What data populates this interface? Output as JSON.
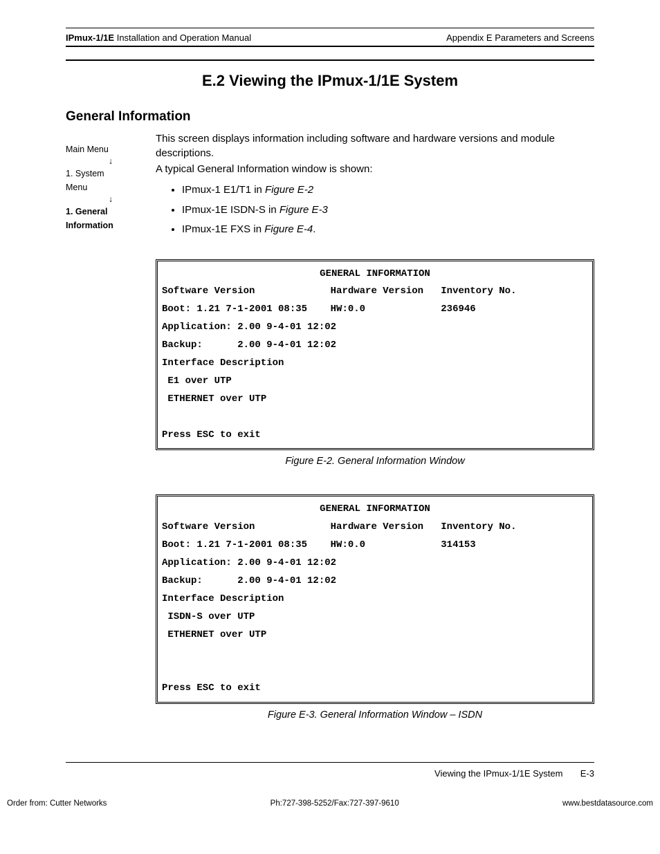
{
  "header": {
    "left_bold": "IPmux-1/1E",
    "left_rest": " Installation and Operation Manual",
    "right": "Appendix E  Parameters and Screens"
  },
  "section_title": "E.2  Viewing the IPmux-1/1E System",
  "subhead": "General Information",
  "breadcrumb": {
    "l1": "Main Menu",
    "l2": "1. System",
    "l3": "Menu",
    "l4a": "1. General",
    "l4b": "Information"
  },
  "intro": {
    "p1": "This screen displays information including software and hardware versions and module descriptions.",
    "p2": "A typical General Information window is shown:"
  },
  "bullets": [
    {
      "text": "IPmux-1 E1/T1 in ",
      "fig": "Figure E-2"
    },
    {
      "text": "IPmux-1E ISDN-S in ",
      "fig": "Figure E-3"
    },
    {
      "text": "IPmux-1E FXS in ",
      "fig": "Figure E-4",
      "tail": "."
    }
  ],
  "term1": {
    "title": "GENERAL INFORMATION",
    "row_hdr": "Software Version             Hardware Version   Inventory No.",
    "boot": "Boot: 1.21 7-1-2001 08:35    HW:0.0             236946",
    "app": "Application: 2.00 9-4-01 12:02",
    "bak": "Backup:      2.00 9-4-01 12:02",
    "ifd": "Interface Description",
    "if1": " E1 over UTP",
    "if2": " ETHERNET over UTP",
    "exit": "Press ESC to exit"
  },
  "cap1": "Figure E-2.  General Information Window",
  "term2": {
    "title": "GENERAL INFORMATION",
    "row_hdr": "Software Version             Hardware Version   Inventory No.",
    "boot": "Boot: 1.21 7-1-2001 08:35    HW:0.0             314153",
    "app": "Application: 2.00 9-4-01 12:02",
    "bak": "Backup:      2.00 9-4-01 12:02",
    "ifd": "Interface Description",
    "if1": " ISDN-S over UTP",
    "if2": " ETHERNET over UTP",
    "exit": "Press ESC to exit"
  },
  "cap2": "Figure E-3.  General Information Window – ISDN",
  "footer": {
    "section": "Viewing the IPmux-1/1E System",
    "page": "E-3"
  },
  "bottom": {
    "left": "Order from: Cutter Networks",
    "mid": "Ph:727-398-5252/Fax:727-397-9610",
    "right": "www.bestdatasource.com"
  }
}
